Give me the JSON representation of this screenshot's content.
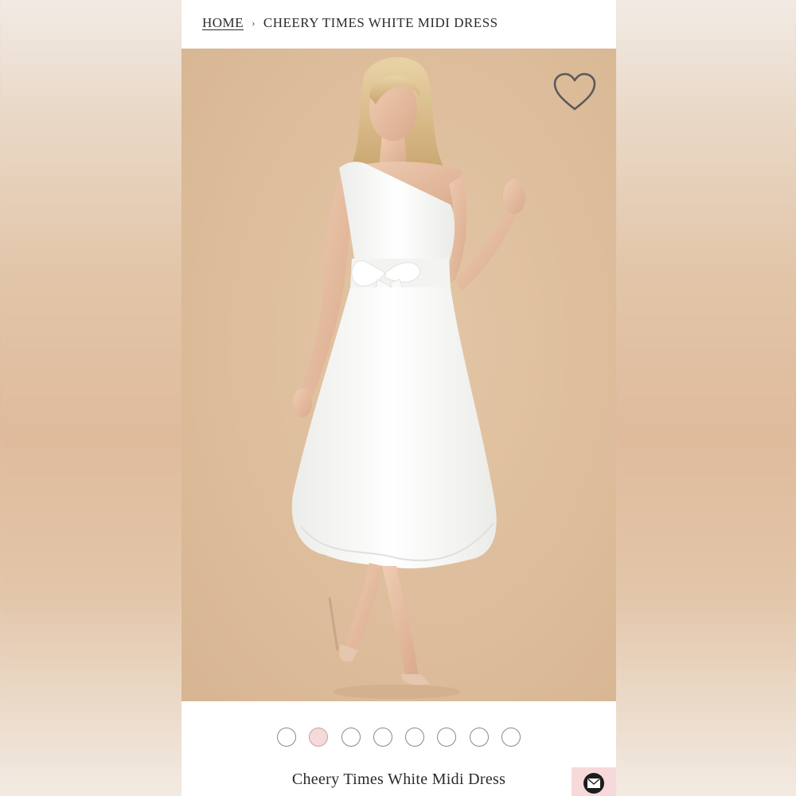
{
  "breadcrumb": {
    "home": "HOME",
    "separator": "›",
    "current": "CHEERY TIMES WHITE MIDI DRESS"
  },
  "gallery": {
    "wishlist_icon": "heart-outline-icon",
    "image_count": 8,
    "active_index": 1
  },
  "product": {
    "title": "Cheery Times White Midi Dress"
  },
  "chat": {
    "icon": "envelope-icon"
  },
  "colors": {
    "accent_pink": "#f6d9da",
    "photo_background": "#ddbd9b",
    "text": "#2b2b2b"
  }
}
